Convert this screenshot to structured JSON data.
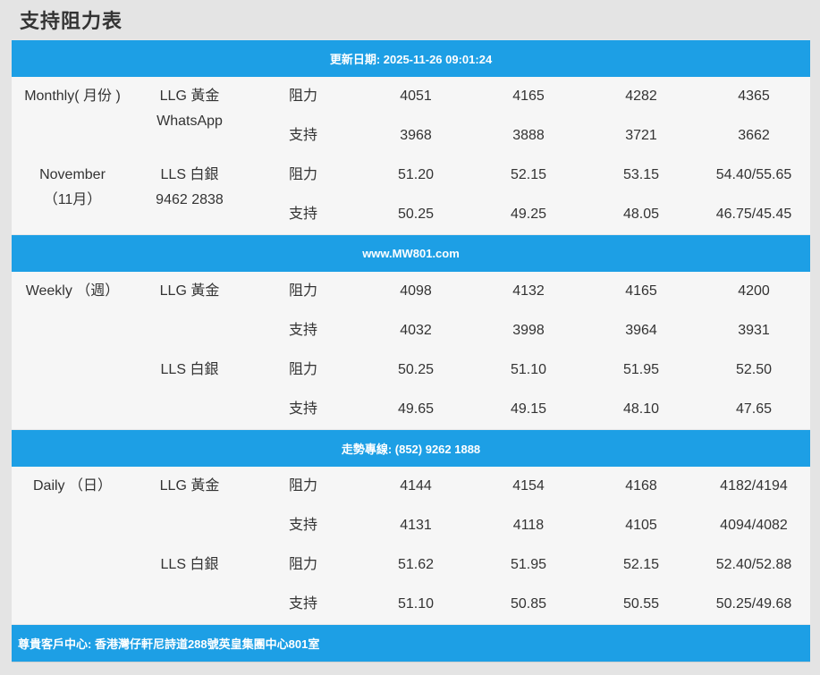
{
  "page_title": "支持阻力表",
  "banners": {
    "update": "更新日期: 2025-11-26 09:01:24",
    "website": "www.MW801.com",
    "hotline": "走勢專線: (852) 9262 1888",
    "address": "尊貴客戶中心: 香港灣仔軒尼詩道288號英皇集團中心801室"
  },
  "monthly": {
    "period_line1": "Monthly( 月份 )",
    "period_line2": "November",
    "period_line3": "（11月）",
    "gold_label": "LLG 黃金",
    "gold_sub": "WhatsApp",
    "silver_label": "LLS 白銀",
    "silver_sub": "9462 2838",
    "rows": [
      {
        "type": "阻力",
        "v": [
          "4051",
          "4165",
          "4282",
          "4365"
        ]
      },
      {
        "type": "支持",
        "v": [
          "3968",
          "3888",
          "3721",
          "3662"
        ]
      },
      {
        "type": "阻力",
        "v": [
          "51.20",
          "52.15",
          "53.15",
          "54.40/55.65"
        ]
      },
      {
        "type": "支持",
        "v": [
          "50.25",
          "49.25",
          "48.05",
          "46.75/45.45"
        ]
      }
    ]
  },
  "weekly": {
    "period_line1": "Weekly （週）",
    "gold_label": "LLG 黃金",
    "silver_label": "LLS 白銀",
    "rows": [
      {
        "type": "阻力",
        "v": [
          "4098",
          "4132",
          "4165",
          "4200"
        ]
      },
      {
        "type": "支持",
        "v": [
          "4032",
          "3998",
          "3964",
          "3931"
        ]
      },
      {
        "type": "阻力",
        "v": [
          "50.25",
          "51.10",
          "51.95",
          "52.50"
        ]
      },
      {
        "type": "支持",
        "v": [
          "49.65",
          "49.15",
          "48.10",
          "47.65"
        ]
      }
    ]
  },
  "daily": {
    "period_line1": "Daily （日）",
    "gold_label": "LLG 黃金",
    "silver_label": "LLS 白銀",
    "rows": [
      {
        "type": "阻力",
        "v": [
          "4144",
          "4154",
          "4168",
          "4182/4194"
        ]
      },
      {
        "type": "支持",
        "v": [
          "4131",
          "4118",
          "4105",
          "4094/4082"
        ]
      },
      {
        "type": "阻力",
        "v": [
          "51.62",
          "51.95",
          "52.15",
          "52.40/52.88"
        ]
      },
      {
        "type": "支持",
        "v": [
          "51.10",
          "50.85",
          "50.55",
          "50.25/49.68"
        ]
      }
    ]
  }
}
